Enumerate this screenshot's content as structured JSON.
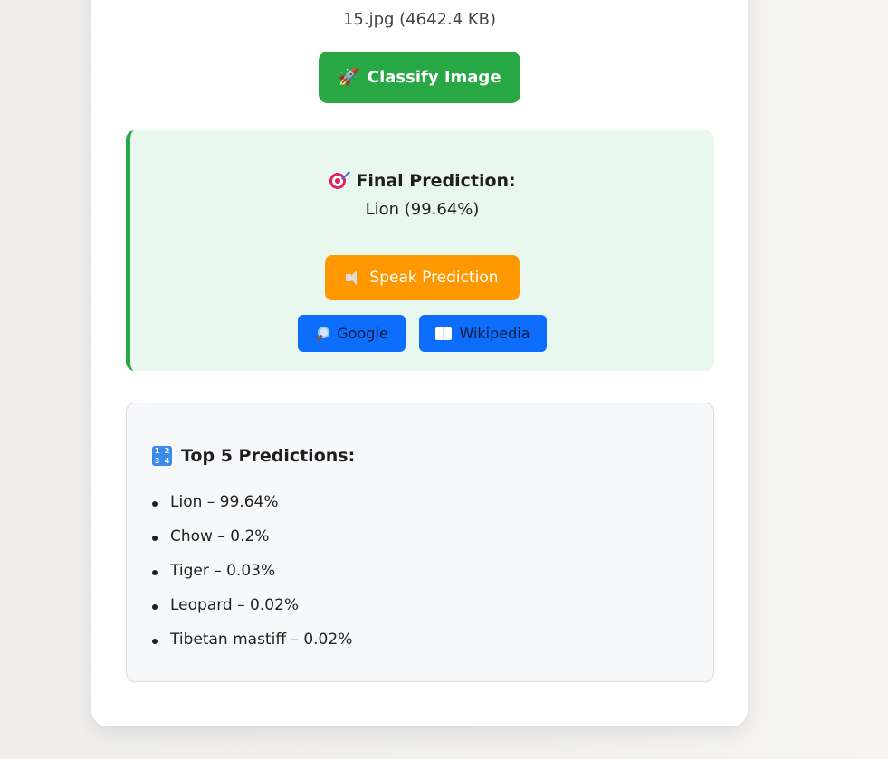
{
  "file": {
    "info": "15.jpg (4642.4 KB)"
  },
  "classify": {
    "label": "Classify Image",
    "icon": "rocket-icon",
    "color": "#28a745"
  },
  "result": {
    "title": "Final Prediction:",
    "title_icon": "target-icon",
    "value": "Lion (99.64%)",
    "speak_label": "Speak Prediction",
    "speak_icon": "speaker-icon",
    "speak_color": "#ff9800",
    "google_label": "Google",
    "google_icon": "magnifier-icon",
    "wikipedia_label": "Wikipedia",
    "wikipedia_icon": "book-icon",
    "link_color": "#0d6efd",
    "panel_color": "#e9f8ee"
  },
  "top5": {
    "title": "Top 5 Predictions:",
    "title_icon": "numbers-1234-icon",
    "icon_digits": [
      "1",
      "2",
      "3",
      "4"
    ],
    "items": [
      "Lion – 99.64%",
      "Chow – 0.2%",
      "Tiger – 0.03%",
      "Leopard – 0.02%",
      "Tibetan mastiff – 0.02%"
    ]
  }
}
